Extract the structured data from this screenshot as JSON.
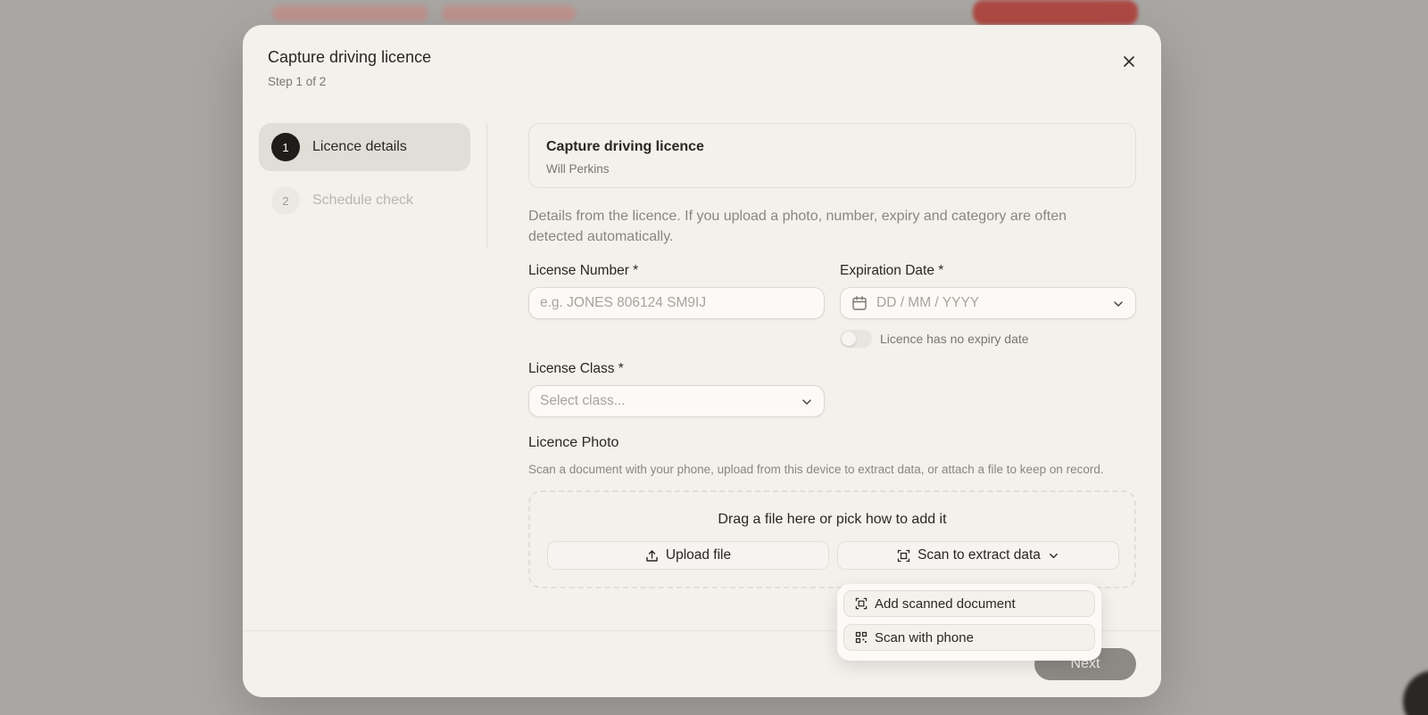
{
  "dialog": {
    "title": "Capture driving licence",
    "step_indicator": "Step 1 of 2"
  },
  "steps": [
    {
      "number": "1",
      "label": "Licence details",
      "state": "active"
    },
    {
      "number": "2",
      "label": "Schedule check",
      "state": "inactive"
    }
  ],
  "summary": {
    "title": "Capture driving licence",
    "person": "Will Perkins"
  },
  "description": "Details from the licence. If you upload a photo, number, expiry and category are often detected automatically.",
  "fields": {
    "license_number": {
      "label": "License Number *",
      "placeholder": "e.g. JONES 806124 SM9IJ"
    },
    "expiration_date": {
      "label": "Expiration Date *",
      "placeholder": "DD / MM / YYYY"
    },
    "no_expiry_toggle": {
      "label": "Licence has no expiry date",
      "checked": false
    },
    "license_class": {
      "label": "License Class *",
      "placeholder": "Select class..."
    }
  },
  "photo": {
    "title": "Licence Photo",
    "description": "Scan a document with your phone, upload from this device to extract data, or attach a file to keep on record.",
    "dropzone_text": "Drag a file here or pick how to add it",
    "upload_label": "Upload file",
    "scan_label": "Scan to extract data"
  },
  "scan_menu": {
    "items": [
      {
        "label": "Add scanned document",
        "icon": "scan-icon"
      },
      {
        "label": "Scan with phone",
        "icon": "qr-icon"
      }
    ]
  },
  "footer": {
    "next_label": "Next"
  },
  "colors": {
    "overlay": "#a9a7a3",
    "modal_bg": "#f3f1ec",
    "active_step_bg": "#e1ddd7",
    "primary_dark": "#1f1c19",
    "next_button_disabled": "#8d8a85"
  }
}
